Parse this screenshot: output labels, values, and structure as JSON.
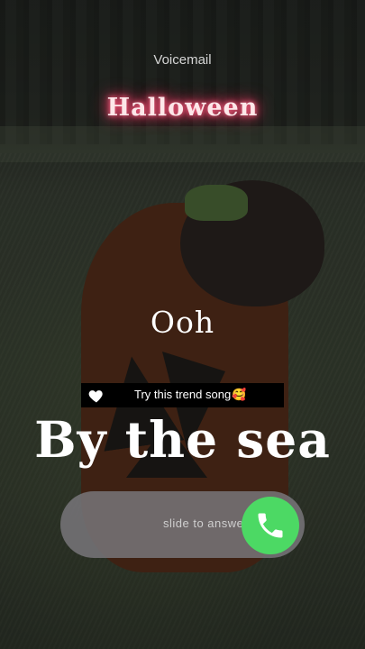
{
  "header": {
    "title": "Voicemail"
  },
  "overlay": {
    "halloween": "Halloween",
    "ooh": "Ooh",
    "banner_text": "Try this trend song",
    "banner_emoji": "🥰",
    "headline": "By the sea"
  },
  "call": {
    "slide_label": "slide to answer",
    "answer_icon": "phone-icon",
    "accent": "#4cd964"
  },
  "colors": {
    "glow": "#ff3d6b",
    "slider_bg": "#78767a"
  }
}
